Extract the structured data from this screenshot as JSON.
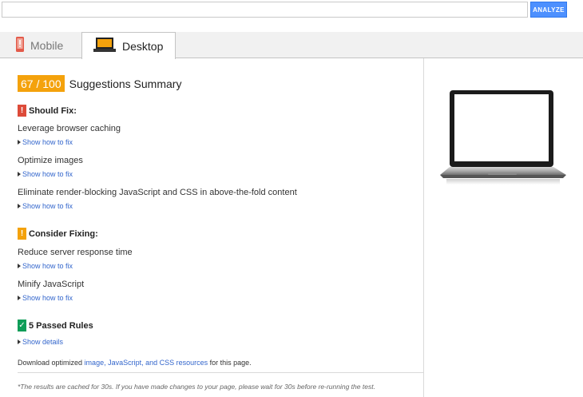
{
  "toolbar": {
    "url_value": "",
    "url_placeholder": "",
    "analyze_label": "ANALYZE"
  },
  "tabs": [
    {
      "label": "Mobile",
      "icon": "mobile-phone-icon",
      "active": false
    },
    {
      "label": "Desktop",
      "icon": "desktop-monitor-icon",
      "active": true
    }
  ],
  "summary": {
    "score": "67 / 100",
    "title": "Suggestions Summary"
  },
  "should_fix": {
    "flag": "!",
    "heading": "Should Fix:",
    "rules": [
      {
        "name": "Leverage browser caching",
        "link": "Show how to fix"
      },
      {
        "name": "Optimize images",
        "link": "Show how to fix"
      },
      {
        "name": "Eliminate render-blocking JavaScript and CSS in above-the-fold content",
        "link": "Show how to fix"
      }
    ]
  },
  "consider_fixing": {
    "flag": "!",
    "heading": "Consider Fixing:",
    "rules": [
      {
        "name": "Reduce server response time",
        "link": "Show how to fix"
      },
      {
        "name": "Minify JavaScript",
        "link": "Show how to fix"
      }
    ]
  },
  "passed": {
    "flag": "✓",
    "heading": "5 Passed Rules",
    "link": "Show details"
  },
  "download": {
    "prefix": "Download optimized",
    "link": "image, JavaScript, and CSS resources",
    "suffix": "for this page."
  },
  "cache_note": "*The results are cached for 30s. If you have made changes to your page, please wait for 30s before re-running the test.",
  "colors": {
    "score_badge": "#f4a20c",
    "should_fix": "#dd4b39",
    "consider_fixing": "#f4a20c",
    "passed": "#0f9d58",
    "link": "#3366cc",
    "analyze_button": "#4d90fe"
  }
}
